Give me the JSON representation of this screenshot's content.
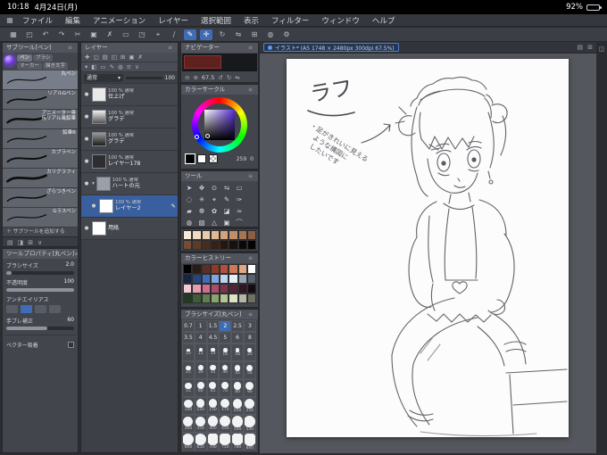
{
  "colors": {
    "accent": "#3f6cb4",
    "selected_layer": "#3a5f9e",
    "canvas_bg": "#54575d",
    "page": "#fcfcfc"
  },
  "status_bar": {
    "time": "10:18",
    "date": "4月24日(月)",
    "battery_pct": "92%"
  },
  "menu_bar": {
    "items": [
      "ファイル",
      "編集",
      "アニメーション",
      "レイヤー",
      "選択範囲",
      "表示",
      "フィルター",
      "ウィンドウ",
      "ヘルプ"
    ]
  },
  "toolbar": {
    "icons": [
      {
        "name": "workspace-grid-icon",
        "glyph": "▦"
      },
      {
        "name": "save-icon",
        "glyph": "◰"
      },
      {
        "name": "undo-icon",
        "glyph": "↶"
      },
      {
        "name": "redo-icon",
        "glyph": "↷"
      },
      {
        "name": "cut-icon",
        "glyph": "✂"
      },
      {
        "name": "paste-icon",
        "glyph": "▣"
      },
      {
        "name": "delete-icon",
        "glyph": "✗"
      },
      {
        "name": "select-rect-icon",
        "glyph": "▭"
      },
      {
        "name": "invert-selection-icon",
        "glyph": "◳"
      },
      {
        "name": "snap-icon",
        "glyph": "⌖"
      },
      {
        "name": "ruler-icon",
        "glyph": "∕"
      },
      {
        "name": "pen-mode-icon",
        "glyph": "✎",
        "active": true
      },
      {
        "name": "touch-mode-icon",
        "glyph": "✛",
        "active": true
      },
      {
        "name": "rotate-canvas-icon",
        "glyph": "↻"
      },
      {
        "name": "flip-canvas-icon",
        "glyph": "⇋"
      },
      {
        "name": "grid-icon",
        "glyph": "⊞"
      },
      {
        "name": "material-icon",
        "glyph": "◍"
      },
      {
        "name": "settings-gear-icon",
        "glyph": "⚙"
      }
    ]
  },
  "subtool": {
    "title": "サブツール[ペン]",
    "tabs": [
      "ペン",
      "ブラシ",
      "マーカー",
      "描き文字"
    ],
    "items": [
      "丸ペン",
      "リアルGペン",
      "アニメーター専用リアル風鉛筆",
      "鉛筆R",
      "カブラペン",
      "カリグラフィ",
      "ざらつきペン",
      "Gラスペン"
    ],
    "selected": "丸ペン",
    "add_label": "＋ サブツールを追加する"
  },
  "tool_property": {
    "title": "ツールプロパティ[丸ペン]",
    "rows": [
      {
        "label": "ブラシサイズ",
        "value": "2.0",
        "pct": 8,
        "type": "slider"
      },
      {
        "label": "不透明度",
        "value": "100",
        "pct": 100,
        "type": "slider"
      },
      {
        "label": "アンチエイリアス",
        "type": "buttons"
      },
      {
        "label": "手ブレ補正",
        "value": "60",
        "pct": 60,
        "type": "slider"
      },
      {
        "label": "ベクター吸着",
        "type": "toggle"
      }
    ]
  },
  "layer_panel": {
    "blend_mode": "通常",
    "opacity": "100",
    "layers": [
      {
        "info": "100 % 通常",
        "name": "仕上げ",
        "thumb": "#e9e9e9",
        "eye": true
      },
      {
        "info": "100 % 通常",
        "name": "グラデ",
        "thumb": "grad1",
        "eye": true
      },
      {
        "info": "100 % 通常",
        "name": "グラデ",
        "thumb": "grad2",
        "eye": true
      },
      {
        "info": "100 % 通常",
        "name": "レイヤー178",
        "thumb": "#2e2e30",
        "eye": true
      },
      {
        "info": "100 % 通常",
        "name": "ハートの元",
        "type": "folder",
        "eye": true
      },
      {
        "info": "100 % 通常",
        "name": "レイヤー2",
        "thumb": "#ffffff",
        "selected": true,
        "child": true,
        "eye": true
      },
      {
        "info": "",
        "name": "用紙",
        "thumb": "#ffffff",
        "eye": true
      }
    ]
  },
  "navigator": {
    "title": "ナビゲーター",
    "zoom": "67.5"
  },
  "color_wheel": {
    "title": "カラーサークル",
    "main": "#000000",
    "sub": "#ffffff",
    "hue": "259",
    "sv": "0"
  },
  "tools_panel": {
    "title": "ツール",
    "icons": [
      {
        "name": "operation-tool-icon",
        "glyph": "➤"
      },
      {
        "name": "move-tool-icon",
        "glyph": "✥"
      },
      {
        "name": "zoom-tool-icon",
        "glyph": "⊙"
      },
      {
        "name": "flip-view-icon",
        "glyph": "⇋"
      },
      {
        "name": "marquee-tool-icon",
        "glyph": "▭"
      },
      {
        "name": "lasso-tool-icon",
        "glyph": "◌"
      },
      {
        "name": "wand-tool-icon",
        "glyph": "✳"
      },
      {
        "name": "eyedropper-tool-icon",
        "glyph": "⌖"
      },
      {
        "name": "pen-tool-icon",
        "glyph": "✎"
      },
      {
        "name": "pencil-tool-icon",
        "glyph": "✑"
      },
      {
        "name": "brush-tool-icon",
        "glyph": "▰"
      },
      {
        "name": "airbrush-tool-icon",
        "glyph": "❆"
      },
      {
        "name": "decoration-tool-icon",
        "glyph": "✿"
      },
      {
        "name": "eraser-tool-icon",
        "glyph": "◪"
      },
      {
        "name": "blend-tool-icon",
        "glyph": "≈"
      },
      {
        "name": "fill-tool-icon",
        "glyph": "◍"
      },
      {
        "name": "gradient-tool-icon",
        "glyph": "▨"
      },
      {
        "name": "figure-tool-icon",
        "glyph": "△"
      },
      {
        "name": "frame-tool-icon",
        "glyph": "▣"
      },
      {
        "name": "ruler-tool-icon",
        "glyph": "⌒"
      },
      {
        "name": "text-tool-icon",
        "glyph": "A"
      },
      {
        "name": "balloon-tool-icon",
        "glyph": "◓"
      },
      {
        "name": "correct-line-tool-icon",
        "glyph": "✚"
      },
      {
        "name": "mask-tool-icon",
        "glyph": "◧"
      }
    ]
  },
  "palette_top": {
    "rows": [
      [
        "#f6ead9",
        "#f0dcc4",
        "#e8cbab",
        "#dfb995",
        "#d2a47e",
        "#c08e69",
        "#a87553",
        "#8d5e41"
      ],
      [
        "#744b33",
        "#5e3a27",
        "#4a2c1d",
        "#382015",
        "#27160e",
        "#191009",
        "#0d0a06",
        "#050403"
      ]
    ]
  },
  "color_history": {
    "title": "カラーヒストリー",
    "rows": [
      [
        "#000000",
        "#2b1b16",
        "#5c2f23",
        "#8c3a28",
        "#b05038",
        "#cf7a55",
        "#e0a883",
        "#ffffff"
      ],
      [
        "#16243f",
        "#274678",
        "#3f6cb4",
        "#7fa7dd",
        "#bcd4ef",
        "#e8eef6",
        "#9aa3ad",
        "#59616c"
      ],
      [
        "#f3c9d3",
        "#e69cb0",
        "#cf6d8a",
        "#a94c69",
        "#7c324b",
        "#512336",
        "#2f1722",
        "#170b11"
      ],
      [
        "#24391f",
        "#3f5c36",
        "#5f7f4e",
        "#87a46b",
        "#b2c694",
        "#dce4c2",
        "#b5b6a6",
        "#6f6f64"
      ]
    ]
  },
  "brush_size": {
    "title": "ブラシサイズ[丸ペン]",
    "selected": "2",
    "number_cells": [
      "0.7",
      "1",
      "1.5",
      "2",
      "2.5",
      "3",
      "3.5",
      "4",
      "4.5",
      "5",
      "6",
      "8"
    ],
    "circle_cells": [
      "10",
      "12",
      "14",
      "16",
      "18",
      "20",
      "25",
      "30",
      "35",
      "40",
      "45",
      "50",
      "55",
      "60",
      "65",
      "70",
      "80",
      "90",
      "100",
      "120",
      "150",
      "170",
      "200",
      "250",
      "300",
      "350",
      "400",
      "450",
      "500",
      "550",
      "600",
      "650",
      "700",
      "750",
      "780",
      "800"
    ]
  },
  "canvas": {
    "tab_label": "イラスト* (A5 1748 × 2480px 300dpi 67.5%)",
    "annotation": "ラフ",
    "note_lines": [
      "・足がきれいに見える",
      "　ような構図に",
      "　したいです"
    ]
  }
}
